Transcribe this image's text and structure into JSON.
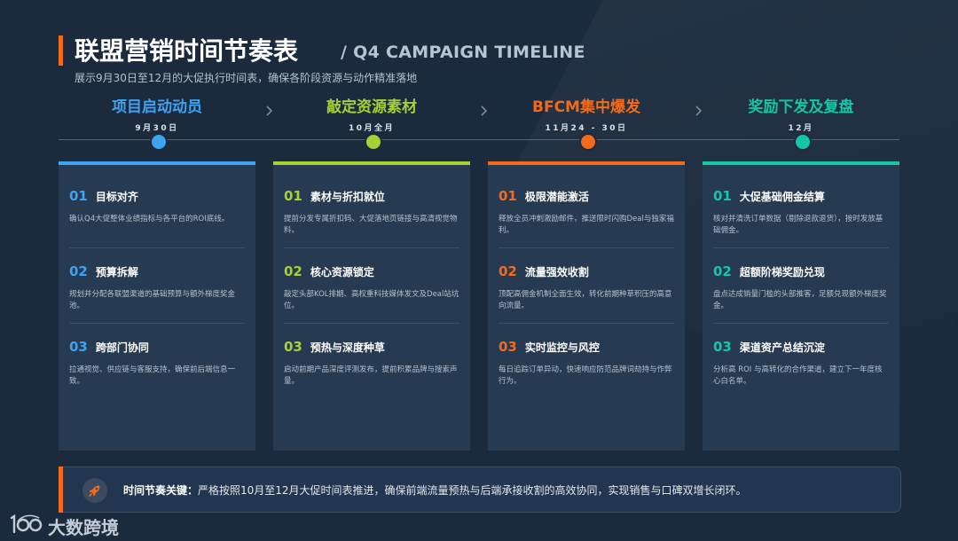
{
  "header": {
    "title": "联盟营销时间节奏表",
    "subtitle_en": "/ Q4 CAMPAIGN TIMELINE",
    "description": "展示9月30日至12月的大促执行时间表，确保各阶段资源与动作精准落地"
  },
  "colors": {
    "phase1": "#3fa3f2",
    "phase2": "#a7d134",
    "phase3": "#f26b1d",
    "phase4": "#13c7a6",
    "accent": "#f26b1d"
  },
  "phases": [
    {
      "name": "项目启动动员",
      "date": "9月30日",
      "items": [
        {
          "num": "01",
          "title": "目标对齐",
          "text": "确认Q4大促整体业绩指标与各平台的ROI底线。"
        },
        {
          "num": "02",
          "title": "预算拆解",
          "text": "规划并分配各联盟渠道的基础预算与额外梯度奖金池。"
        },
        {
          "num": "03",
          "title": "跨部门协同",
          "text": "拉通视觉、供应链与客服支持，确保前后端信息一致。"
        }
      ]
    },
    {
      "name": "敲定资源素材",
      "date": "10月全月",
      "items": [
        {
          "num": "01",
          "title": "素材与折扣就位",
          "text": "提前分发专属折扣码、大促落地页链接与高清视觉物料。"
        },
        {
          "num": "02",
          "title": "核心资源锁定",
          "text": "敲定头部KOL排期、高权重科技媒体发文及Deal站坑位。"
        },
        {
          "num": "03",
          "title": "预热与深度种草",
          "text": "启动前期产品深度评测发布，提前积累品牌与搜索声量。"
        }
      ]
    },
    {
      "name": "BFCM集中爆发",
      "date": "11月24 - 30日",
      "items": [
        {
          "num": "01",
          "title": "极限潜能激活",
          "text": "释放全员冲刺激励邮件，推送限时闪购Deal与独家福利。"
        },
        {
          "num": "02",
          "title": "流量强效收割",
          "text": "顶配高佣金机制全面生效，转化前期种草积压的高意向流量。"
        },
        {
          "num": "03",
          "title": "实时监控与风控",
          "text": "每日追踪订单异动，快速响应防范品牌词劫持与作弊行为。"
        }
      ]
    },
    {
      "name": "奖励下发及复盘",
      "date": "12月",
      "items": [
        {
          "num": "01",
          "title": "大促基础佣金结算",
          "text": "核对并清洗订单数据（剔除退款退货），按时发放基础佣金。"
        },
        {
          "num": "02",
          "title": "超额阶梯奖励兑现",
          "text": "盘点达成销量门槛的头部推客，足额兑现额外梯度奖金。"
        },
        {
          "num": "03",
          "title": "渠道资产总结沉淀",
          "text": "分析高 ROI 与高转化的合作渠道，建立下一年度核心白名单。"
        }
      ]
    }
  ],
  "footer": {
    "label": "时间节奏关键：",
    "text": "严格按照10月至12月大促时间表推进，确保前端流量预热与后端承接收割的高效协同，实现销售与口碑双增长闭环。",
    "icon": "rocket-icon"
  },
  "brand": {
    "name": "大数跨境",
    "logo_mark": "100"
  }
}
